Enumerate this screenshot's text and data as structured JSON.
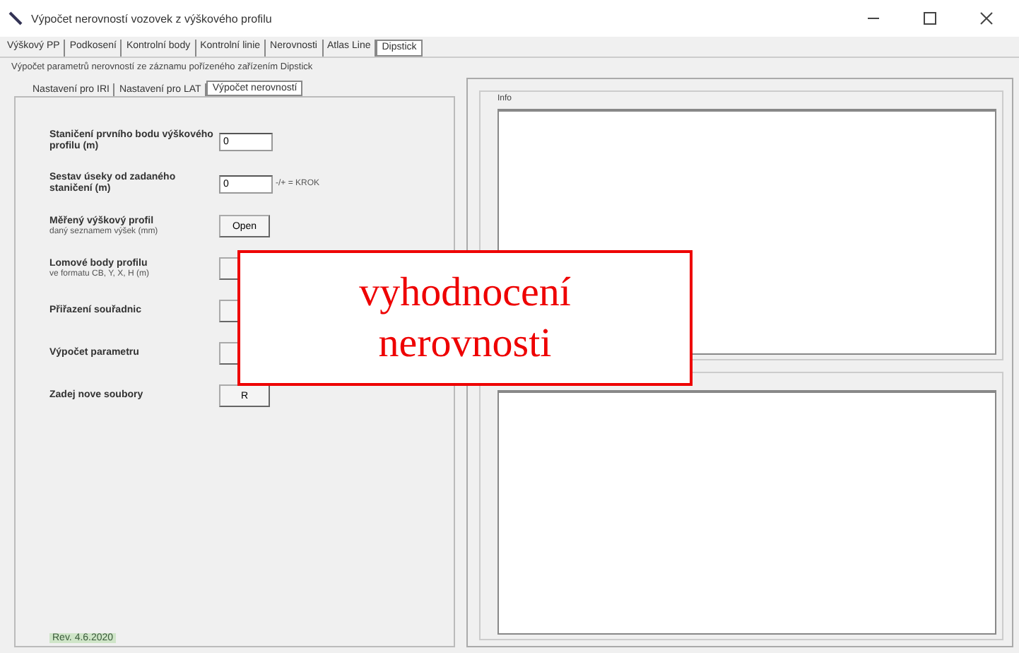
{
  "window": {
    "title": "Výpočet nerovností vozovek z výškového profilu"
  },
  "main_tabs": [
    {
      "label": "Výškový PP",
      "selected": false
    },
    {
      "label": "Podkosení",
      "selected": false
    },
    {
      "label": "Kontrolní body",
      "selected": false
    },
    {
      "label": "Kontrolní linie",
      "selected": false
    },
    {
      "label": "Nerovnosti",
      "selected": false
    },
    {
      "label": "Atlas Line",
      "selected": false
    },
    {
      "label": "Dipstick",
      "selected": true
    }
  ],
  "group_caption": "Výpočet parametrů nerovností ze záznamu pořízeného zařízením Dipstick",
  "inner_tabs": [
    {
      "label": "Nastavení pro IRI",
      "selected": false
    },
    {
      "label": "Nastavení pro LAT",
      "selected": false
    },
    {
      "label": "Výpočet nerovností",
      "selected": true
    }
  ],
  "form_rows": [
    {
      "kind": "input",
      "label": "Staničení prvního bodu výškového profilu (m)",
      "value": "0"
    },
    {
      "kind": "input",
      "label": "Sestav úseky od zadaného staničení (m)",
      "value": "0",
      "note": "-/+ = KROK"
    },
    {
      "kind": "button",
      "label": "Měřený výškový profil",
      "sublabel": "daný seznamem výšek (mm)",
      "button": "Open"
    },
    {
      "kind": "button",
      "label": "Lomové body profilu",
      "sublabel": "ve formatu CB, Y, X, H (m)"
    },
    {
      "kind": "button",
      "label": "Přiřazení souřadnic"
    },
    {
      "kind": "button",
      "label": "Výpočet parametru"
    },
    {
      "kind": "button",
      "label": "Zadej nove soubory",
      "button": "R"
    }
  ],
  "revision": "Rev. 4.6.2020",
  "info_group": {
    "caption": "Info"
  },
  "callout": {
    "lines": [
      "vyhodnocení",
      "nerovnosti"
    ]
  }
}
